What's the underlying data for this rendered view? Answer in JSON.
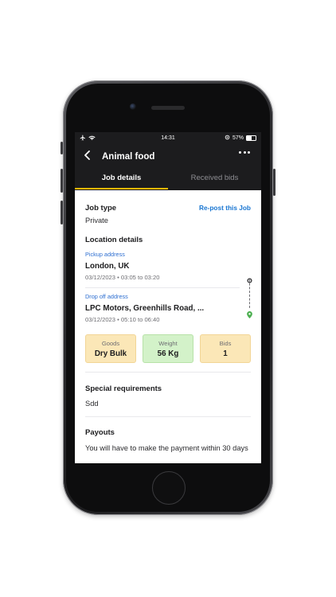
{
  "status_bar": {
    "time": "14:31",
    "battery": "57%"
  },
  "app_bar": {
    "title": "Animal food"
  },
  "tabs": [
    {
      "label": "Job details",
      "active": true
    },
    {
      "label": "Received bids",
      "active": false
    }
  ],
  "job_type": {
    "heading": "Job type",
    "value": "Private",
    "repost_label": "Re-post this Job"
  },
  "location": {
    "heading": "Location details",
    "pickup": {
      "label": "Pickup address",
      "address": "London, UK",
      "datetime": "03/12/2023 • 03:05 to 03:20"
    },
    "dropoff": {
      "label": "Drop off address",
      "address": "LPC Motors, Greenhills Road, ...",
      "datetime": "03/12/2023 • 05:10 to 06:40"
    }
  },
  "chips": [
    {
      "label": "Goods",
      "value": "Dry Bulk",
      "color": "#fbe7b7"
    },
    {
      "label": "Weight",
      "value": "56 Kg",
      "color": "#d3f2c9"
    },
    {
      "label": "Bids",
      "value": "1",
      "color": "#fbe7b7"
    }
  ],
  "special_requirements": {
    "heading": "Special requirements",
    "value": "Sdd"
  },
  "payouts": {
    "heading": "Payouts",
    "text": "You will have to make the payment within 30 days"
  },
  "colors": {
    "accent": "#f2b705",
    "link": "#1976d2",
    "dropoff_pin": "#4caf50"
  }
}
